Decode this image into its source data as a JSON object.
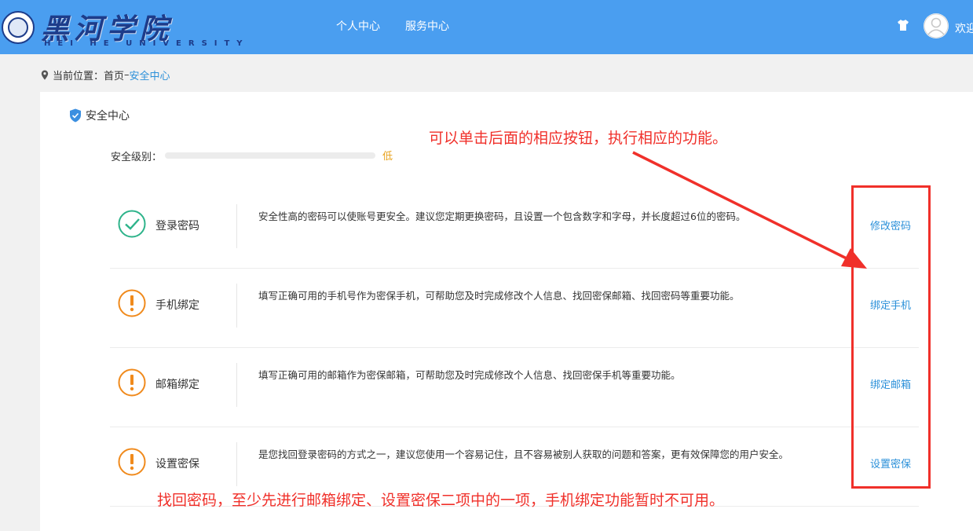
{
  "header": {
    "brand": "黑河学院",
    "brand_sub": "HEI HE UNIVERSITY",
    "nav": [
      "个人中心",
      "服务中心"
    ],
    "welcome": "欢迎"
  },
  "breadcrumb": {
    "prefix": "当前位置：",
    "home": "首页",
    "separator": "–",
    "current": "安全中心"
  },
  "security": {
    "title": "安全中心",
    "level_label": "安全级别：",
    "level_value": "低",
    "level_fraction": 0,
    "items": [
      {
        "name": "登录密码",
        "status": "ok",
        "desc": "安全性高的密码可以使账号更安全。建议您定期更换密码，且设置一个包含数字和字母，并长度超过6位的密码。",
        "action": "修改密码"
      },
      {
        "name": "手机绑定",
        "status": "warning",
        "desc": "填写正确可用的手机号作为密保手机，可帮助您及时完成修改个人信息、找回密保邮箱、找回密码等重要功能。",
        "action": "绑定手机"
      },
      {
        "name": "邮箱绑定",
        "status": "warning",
        "desc": "填写正确可用的邮箱作为密保邮箱，可帮助您及时完成修改个人信息、找回密保手机等重要功能。",
        "action": "绑定邮箱"
      },
      {
        "name": "设置密保",
        "status": "warning",
        "desc": "是您找回登录密码的方式之一，建议您使用一个容易记住，且不容易被别人获取的问题和答案，更有效保障您的用户安全。",
        "action": "设置密保"
      }
    ]
  },
  "annotations": {
    "top": "可以单击后面的相应按钮，执行相应的功能。",
    "bottom": "找回密码，至少先进行邮箱绑定、设置密保二项中的一项，手机绑定功能暂时不可用。"
  },
  "colors": {
    "header_bg": "#4a9ef0",
    "link": "#2b90d9",
    "ok": "#2db38a",
    "warning": "#f08a1c",
    "level_low": "#e8a21c",
    "annotation": "#f0302a"
  }
}
